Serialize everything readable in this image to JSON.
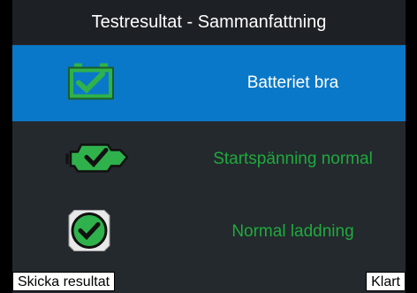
{
  "header": {
    "title": "Testresultat - Sammanfattning"
  },
  "results": [
    {
      "label": "Batteriet bra",
      "icon": "battery-check-icon",
      "selected": true
    },
    {
      "label": "Startspänning normal",
      "icon": "engine-check-icon",
      "selected": false
    },
    {
      "label": "Normal laddning",
      "icon": "alternator-check-icon",
      "selected": false
    }
  ],
  "footer": {
    "send_label": "Skicka resultat",
    "done_label": "Klart"
  },
  "colors": {
    "selected_row": "#0a78c8",
    "ok_green": "#1faa3c",
    "background": "#24292e",
    "title_bar": "#1d2024"
  }
}
